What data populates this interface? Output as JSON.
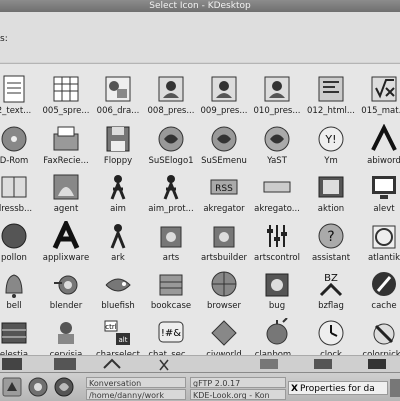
{
  "window": {
    "title": "Select Icon - KDesktop"
  },
  "label_row": {
    "label": "s:"
  },
  "icons": [
    [
      "2_text...",
      "005_spre...",
      "006_dra...",
      "008_pres...",
      "009_pres...",
      "010_pres...",
      "012_html...",
      "015_mat..."
    ],
    [
      "D-Rom",
      "FaxRecie...",
      "Floppy",
      "SuSElogo1",
      "SuSEmenu",
      "YaST",
      "Ym",
      "abiword"
    ],
    [
      "dressb...",
      "agent",
      "aim",
      "aim_prot...",
      "akregator",
      "akregato...",
      "aktion",
      "alevt"
    ],
    [
      "pollon",
      "applixware",
      "ark",
      "arts",
      "artsbuilder",
      "artscontrol",
      "assistant",
      "atlantik"
    ],
    [
      "bell",
      "blender",
      "bluefish",
      "bookcase",
      "browser",
      "bug",
      "bzflag",
      "cache"
    ],
    [
      "elestia",
      "cervisia",
      "charselect",
      "chat_sec...",
      "civworld",
      "clanbom...",
      "clock",
      "colorpicke"
    ]
  ],
  "taskbar": {
    "tasks": [
      {
        "label": "Konversation",
        "active": false
      },
      {
        "label": "/home/danny/work",
        "active": false
      },
      {
        "label": "gFTP 2.0.17",
        "active": false
      },
      {
        "label": "KDE-Look.org - Kon",
        "active": false
      },
      {
        "label": "Properties for da",
        "active": true
      }
    ],
    "close_glyph": "X"
  }
}
